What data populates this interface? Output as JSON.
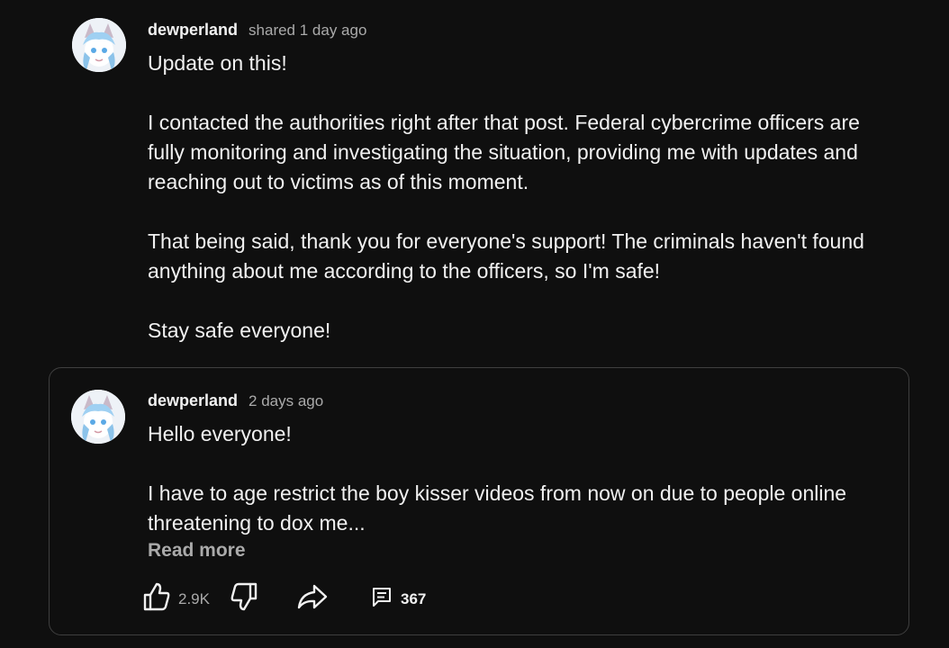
{
  "shared_post": {
    "author": "dewperland",
    "timestamp": "shared 1 day ago",
    "paragraphs": [
      "Update on this!",
      "I contacted the authorities right after that post. Federal cybercrime officers are fully monitoring and investigating the situation, providing me with updates and reaching out to victims as of this moment.",
      "That being said, thank you for everyone's support! The criminals haven't found anything about me according to the officers, so I'm safe!",
      "Stay safe everyone!"
    ]
  },
  "original_post": {
    "author": "dewperland",
    "timestamp": "2 days ago",
    "paragraphs": [
      "Hello everyone!",
      "I have to age restrict the boy kisser videos from now on due to people online threatening to dox me..."
    ],
    "read_more_label": "Read more",
    "likes": "2.9K",
    "comments": "367"
  },
  "icons": {
    "like": "thumbs-up-icon",
    "dislike": "thumbs-down-icon",
    "share": "share-arrow-icon",
    "comment": "comment-icon"
  },
  "colors": {
    "background": "#0f0f0f",
    "text": "#f1f1f1",
    "secondary_text": "#aaaaaa",
    "card_border": "#3f3f3f"
  }
}
